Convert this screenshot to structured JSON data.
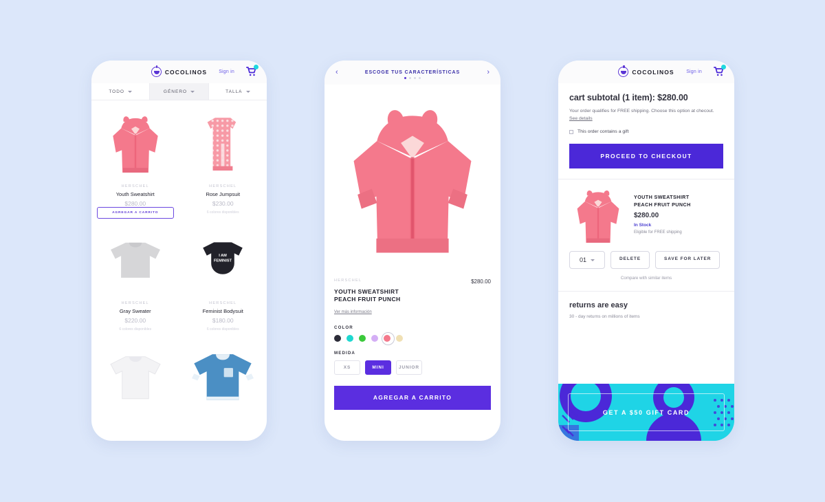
{
  "background_color": "#dce7fa",
  "brand": {
    "name": "COCOLINOS",
    "accent_purple": "#5b2ee0",
    "accent_cyan": "#1fd4e6",
    "logo_icon": "cocolinos-face-logo"
  },
  "phone_list": {
    "header": {
      "logo": "COCOLINOS",
      "signin_label": "Sign in",
      "cart_icon": "shopping-cart-icon"
    },
    "filters": [
      {
        "label": "TODO",
        "active": false
      },
      {
        "label": "GÉNERO",
        "active": true
      },
      {
        "label": "TALLA",
        "active": false
      }
    ],
    "products": [
      {
        "brand": "HERSCHEL",
        "name": "Youth Sweatshirt",
        "price": "$280.00",
        "meta": "",
        "add_to_cart_label": "AGREGAR A CARRITO",
        "image": "pink-hooded-sweatshirt",
        "colors": [
          "#2c2c38",
          "#1fd8d0",
          "#3bc93b",
          "#d4aef5",
          "#f4798c",
          "#f0e0b4"
        ],
        "selected_color_index": 4
      },
      {
        "brand": "HERSCHEL",
        "name": "Rose Jumpsuit",
        "price": "$230.00",
        "meta": "6 colores disponibles",
        "image": "rose-polkadot-jumpsuit"
      },
      {
        "brand": "HERSCHEL",
        "name": "Gray Sweater",
        "price": "$220.00",
        "meta": "6 colores disponibles",
        "image": "gray-sweater"
      },
      {
        "brand": "HERSCHEL",
        "name": "Feminist Bodysuit",
        "price": "$180.00",
        "meta": "6 colores disponibles",
        "image": "black-feminist-bodysuit"
      },
      {
        "brand": "",
        "name": "",
        "price": "",
        "meta": "",
        "image": "white-tshirt"
      },
      {
        "brand": "",
        "name": "",
        "price": "",
        "meta": "",
        "image": "blue-longsleeve-shirt"
      }
    ]
  },
  "phone_detail": {
    "header": {
      "title": "ESCOGE TUS CARACTERÍSTICAS",
      "prev_icon": "chevron-left-icon",
      "next_icon": "chevron-right-icon",
      "pager_dots": 4,
      "pager_active_index": 0
    },
    "hero_image": "pink-hooded-sweatshirt-large",
    "product": {
      "brand": "HERSCHEL",
      "price": "$280.00",
      "name": "YOUTH SWEATSHIRT\nPEACH FRUIT PUNCH",
      "name_line1": "YOUTH SWEATSHIRT",
      "name_line2": "PEACH FRUIT PUNCH",
      "more_info_link": "Ver más información"
    },
    "color_section": {
      "label": "COLOR",
      "swatches": [
        "#2c2c38",
        "#1fd8d0",
        "#3bc93b",
        "#d4aef5",
        "#f4798c",
        "#f0e0b4"
      ],
      "selected_index": 4
    },
    "size_section": {
      "label": "MEDIDA",
      "options": [
        "XS",
        "MINI",
        "JUNIOR"
      ],
      "selected": "MINI"
    },
    "cta_label": "AGREGAR A CARRITO"
  },
  "phone_cart": {
    "header": {
      "logo": "COCOLINOS",
      "signin_label": "Sign in",
      "cart_icon": "shopping-cart-icon"
    },
    "subtotal_text": "cart subtotal (1 item): $280.00",
    "shipping_note_part1": "Your order qualifies for FREE shipping. Choose this option at checout. ",
    "shipping_note_link": "See details",
    "gift_checkbox_label": "This order contains a gift",
    "checkout_label": "PROCEED TO CHECKOUT",
    "item": {
      "name_line1": "YOUTH SWEATSHIRT",
      "name_line2": "PEACH FRUIT PUNCH",
      "price": "$280.00",
      "stock": "In Stock",
      "shipping": "Eligible for FREE shipping",
      "image": "pink-hooded-sweatshirt"
    },
    "quantity": "01",
    "delete_label": "DELETE",
    "save_label": "SAVE FOR LATER",
    "compare_label": "Compare with similar items",
    "returns": {
      "title": "returns are easy",
      "subtitle": "30 - day returns on millions of items"
    },
    "giftcard_label": "GET A $50 GIFT CARD"
  }
}
